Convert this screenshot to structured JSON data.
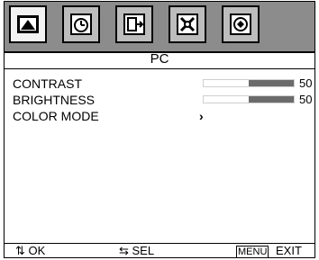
{
  "tabs": [
    {
      "icon": "picture-icon",
      "selected": true
    },
    {
      "icon": "clock-icon",
      "selected": false
    },
    {
      "icon": "input-icon",
      "selected": false
    },
    {
      "icon": "setup-icon",
      "selected": false
    },
    {
      "icon": "display-icon",
      "selected": false
    }
  ],
  "title": "PC",
  "settings": [
    {
      "label": "CONTRAST",
      "value": "50",
      "level": 0.5
    },
    {
      "label": "BRIGHTNESS",
      "value": "50",
      "level": 0.5
    },
    {
      "label": "COLOR MODE",
      "arrow": "›"
    }
  ],
  "footer": {
    "ok": "⇅ OK",
    "sel": "⇆ SEL",
    "menu_key": "MENU",
    "exit": "EXIT"
  },
  "colors": {
    "tabbar": "#8c8c8c",
    "bar_fill": "#6b6b6b"
  }
}
